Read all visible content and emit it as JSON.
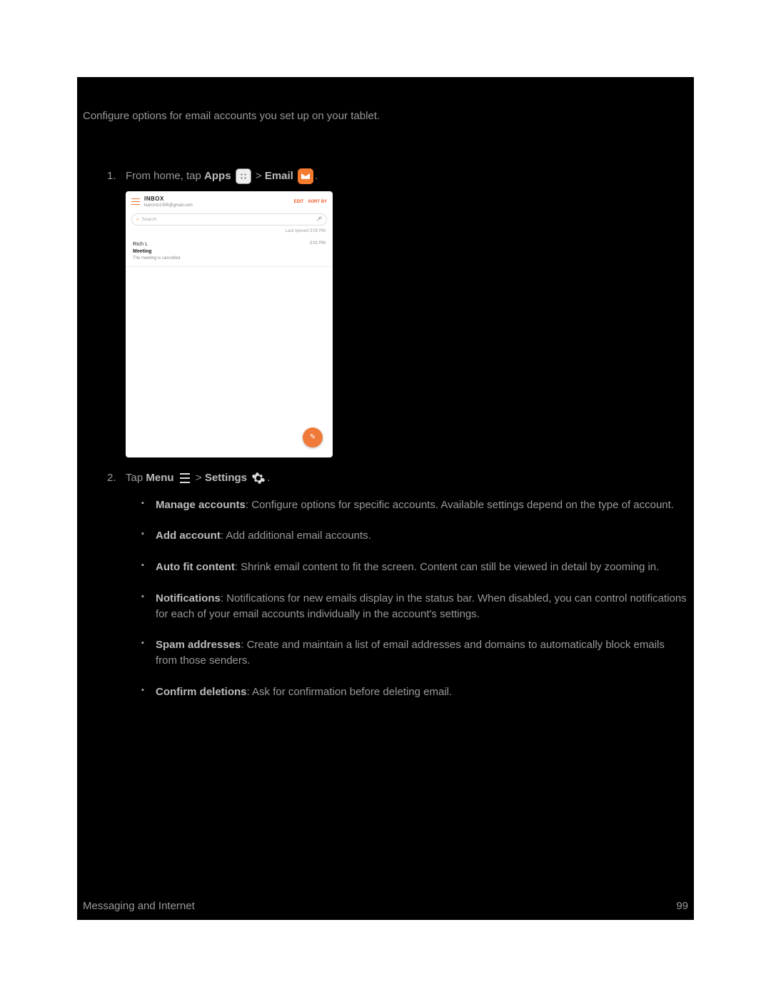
{
  "intro": "Configure options for email accounts you set up on your tablet.",
  "step1": {
    "prefix": "From home, tap ",
    "apps": "Apps",
    "sep": " > ",
    "email": "Email",
    "period": "."
  },
  "screenshot": {
    "inbox_label": "INBOX",
    "account": "learcms1306@gmail.com",
    "edit": "EDIT",
    "sort": "SORT BY",
    "search_placeholder": "Search",
    "last_sync": "Last synced  3:03 PM",
    "row": {
      "sender": "Rich L",
      "time": "3:01 PM",
      "subject": "Meeting",
      "snippet": "The meeting is cancelled."
    }
  },
  "step2": {
    "prefix": "Tap ",
    "menu": "Menu",
    "sep": " > ",
    "settings": "Settings",
    "period": "."
  },
  "bullets": {
    "b1_bold": "Manage accounts",
    "b1_text": ": Configure options for specific accounts. Available settings depend on the type of account.",
    "b2_bold": "Add account",
    "b2_text": ": Add additional email accounts.",
    "b3_bold": "Auto fit content",
    "b3_text": ": Shrink email content to fit the screen. Content can still be viewed in detail by zooming in.",
    "b4_bold": "Notifications",
    "b4_text": ": Notifications for new emails display in the status bar. When disabled, you can control notifications for each of your email accounts individually in the account's settings.",
    "b5_bold": "Spam addresses",
    "b5_text": ": Create and maintain a list of email addresses and domains to automatically block emails from those senders.",
    "b6_bold": "Confirm deletions",
    "b6_text": ": Ask for confirmation before deleting email."
  },
  "footer": {
    "section": "Messaging and Internet",
    "page": "99"
  }
}
